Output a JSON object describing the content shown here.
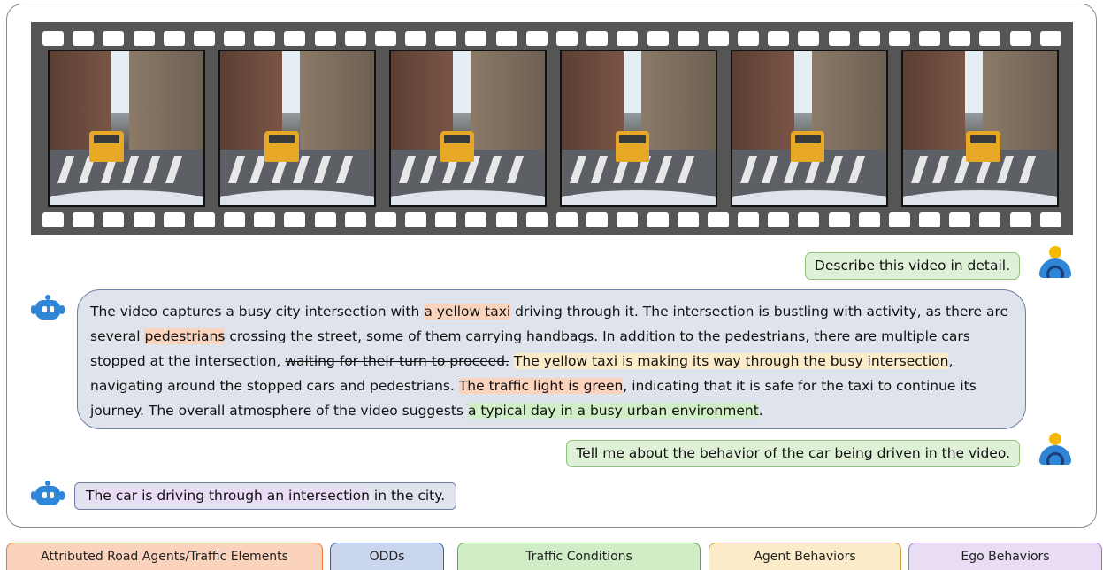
{
  "conversation": {
    "q1": "Describe this video in detail.",
    "a1": {
      "s1": "The video captures a busy city intersection with ",
      "h1": "a yellow taxi",
      "s2": " driving through it. The intersection is bustling with activity, as there are several ",
      "h2": "pedestrians",
      "s3": " crossing the street, some of them carrying handbags. In addition to the pedestrians, there are multiple cars stopped at the intersection, ",
      "struck": "waiting for their turn to proceed.",
      "s4": " ",
      "h3": "The yellow taxi is making its way through the busy intersection",
      "s5": ", navigating around the stopped cars and pedestrians. ",
      "h4": "The traffic light is green",
      "s6": ", indicating that it is safe for the taxi to continue its journey. The overall atmosphere of the video suggests ",
      "h5": "a typical day in a busy urban environment",
      "s7": "."
    },
    "q2": "Tell me about the behavior of the car being driven in the video.",
    "a2": {
      "h1": "The car is driving through an intersection",
      "s1": " in the city."
    }
  },
  "legend": [
    {
      "label": "Attributed Road Agents/Traffic Elements",
      "color": "#fbd3bd",
      "border": "#e07a3a"
    },
    {
      "label": "ODDs",
      "color": "#c9d6ee",
      "border": "#3b5aa8"
    },
    {
      "label": "Traffic Conditions",
      "color": "#cfeec5",
      "border": "#5fa84a"
    },
    {
      "label": "Agent Behaviors",
      "color": "#fbebc8",
      "border": "#d2a23c"
    },
    {
      "label": "Ego Behaviors",
      "color": "#e9ddf6",
      "border": "#9a6cd0"
    }
  ],
  "colors": {
    "bubble_user": "#def0d5",
    "bubble_bot": "#dfe3ec",
    "film": "#555555",
    "panel_border": "#8a8a8a"
  },
  "icons": {
    "user": "user-avatar-icon",
    "bot": "robot-icon"
  },
  "video_frames": 6
}
